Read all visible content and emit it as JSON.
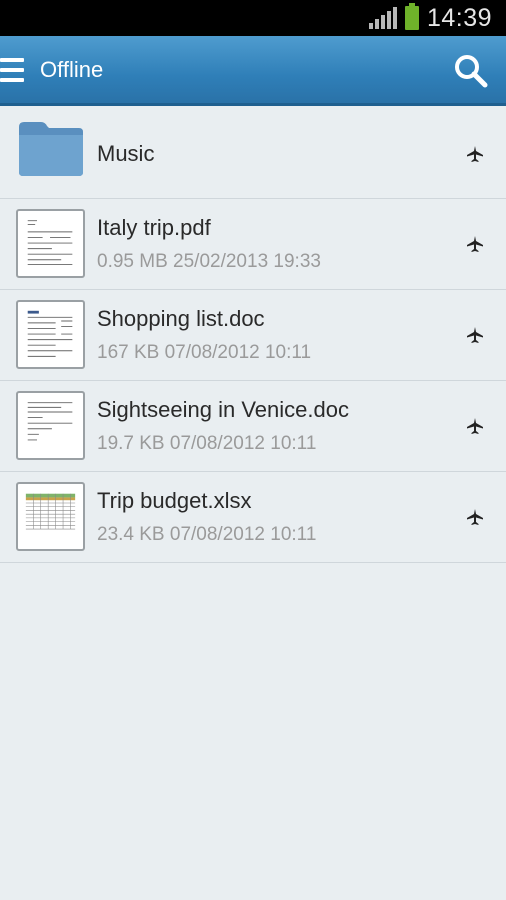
{
  "status_bar": {
    "time": "14:39",
    "signal_icon": "signal-icon",
    "battery_icon": "battery-icon"
  },
  "action_bar": {
    "title": "Offline",
    "menu_icon": "menu-icon",
    "search_icon": "search-icon"
  },
  "items": [
    {
      "type": "folder",
      "name": "Music",
      "meta": ""
    },
    {
      "type": "file",
      "name": "Italy trip.pdf",
      "meta": "0.95 MB 25/02/2013 19:33"
    },
    {
      "type": "file",
      "name": "Shopping list.doc",
      "meta": "167 KB 07/08/2012 10:11"
    },
    {
      "type": "file",
      "name": "Sightseeing in Venice.doc",
      "meta": "19.7 KB 07/08/2012 10:11"
    },
    {
      "type": "file",
      "name": "Trip budget.xlsx",
      "meta": "23.4 KB 07/08/2012 10:11"
    }
  ],
  "colors": {
    "action_bar": "#2f7fb8",
    "background": "#e9eef1",
    "battery": "#6fb22a"
  }
}
